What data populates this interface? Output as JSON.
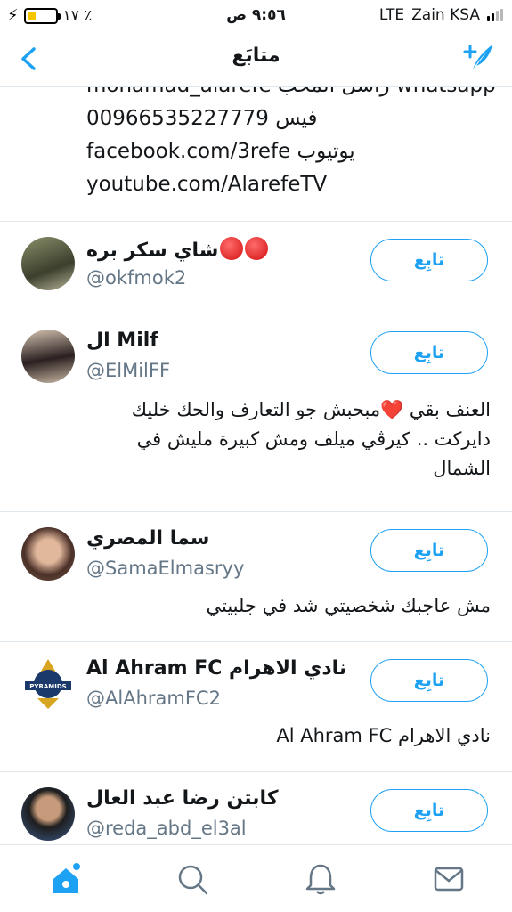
{
  "status": {
    "battery_text": "١٧ ٪",
    "time": "٩:٥٦ ص",
    "network": "LTE",
    "carrier": "Zain KSA",
    "battery_level": 0.3
  },
  "nav": {
    "title": "متابَع"
  },
  "bio_top": {
    "lines": [
      "mohamad_alarefe راسل المحب whatsapp",
      "00966535227779 فيس",
      "facebook.com/3refe يوتيوب",
      "youtube.com/AlarefeTV"
    ]
  },
  "follow_label": "تابِع",
  "users": [
    {
      "name": "شاي سكر بره",
      "handle": "@okfmok2",
      "bio": ""
    },
    {
      "name": "ال Milf",
      "handle": "@ElMilFF",
      "bio_lines": [
        "العنف بقي ❤️مبحبش جو التعارف والحك خليك",
        "دايركت .. كيرڤي ميلف ومش كبيرة مليش في",
        "الشمال"
      ]
    },
    {
      "name": "سما المصري",
      "handle": "@SamaElmasryy",
      "bio": "مش عاجبك شخصيتي شد في جلبيتي"
    },
    {
      "name": "Al Ahram FC نادي الاهرام",
      "handle": "@AlAhramFC2",
      "bio": "نادي الاهرام Al Ahram FC",
      "logo_text": "PYRAMIDS"
    },
    {
      "name": "كابتن رضا عبد العال",
      "handle": "@reda_abd_el3al",
      "bio": ""
    }
  ],
  "colors": {
    "accent": "#1da1f2",
    "secondary_text": "#657786",
    "divider": "#e1e8ed"
  }
}
